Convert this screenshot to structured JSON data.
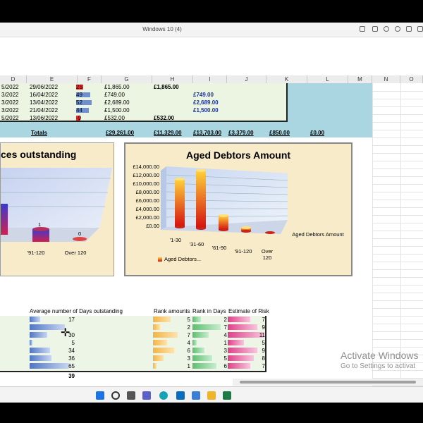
{
  "window": {
    "title": "Windows 10 (4)"
  },
  "colors": {
    "teal": "#a9d6e0",
    "table": "#ecf4e2",
    "blue_text": "#1a33a0",
    "chart_bg": "#f7ebc9"
  },
  "columns": [
    "D",
    "E",
    "F",
    "G",
    "H",
    "I",
    "J",
    "K",
    "L",
    "M",
    "N",
    "O"
  ],
  "rows": [
    {
      "d": "5/2022",
      "e": "29/06/2022",
      "f": "25",
      "g": "£1,865.00",
      "h": "£1,865.00",
      "i": "",
      "f_level": 0.3,
      "f_color": "#e03030"
    },
    {
      "d": "3/2022",
      "e": "16/04/2022",
      "f": "49",
      "g": "£749.00",
      "h": "",
      "i": "£749.00",
      "f_level": 0.55,
      "f_color": "#6f8fd0"
    },
    {
      "d": "3/2022",
      "e": "13/04/2022",
      "f": "52",
      "g": "£2,689.00",
      "h": "",
      "i": "£2,689.00",
      "f_level": 0.6,
      "f_color": "#6f8fd0"
    },
    {
      "d": "3/2022",
      "e": "21/04/2022",
      "f": "44",
      "g": "£1,500.00",
      "h": "",
      "i": "£1,500.00",
      "f_level": 0.5,
      "f_color": "#6f8fd0"
    },
    {
      "d": "5/2022",
      "e": "13/06/2022",
      "f": "-9",
      "g": "£532.00",
      "h": "£532.00",
      "i": "",
      "f_level": 0.1,
      "f_color": "#e03030"
    }
  ],
  "totals": {
    "label": "Totals",
    "g": "£29,261.00",
    "h": "£11,329.00",
    "i": "£13,703.00",
    "j": "£3,379.00",
    "k": "£850.00",
    "l": "£0.00"
  },
  "chart_data": [
    {
      "type": "bar",
      "title": "ces outstanding",
      "categories": [
        "'91-120",
        "Over 120"
      ],
      "values": [
        1,
        0
      ],
      "data_labels": [
        "1",
        "0"
      ]
    },
    {
      "type": "bar",
      "title": "Aged Debtors Amount",
      "categories": [
        "'1-30",
        "'31-60",
        "'61-90",
        "'91-120",
        "Over 120"
      ],
      "values": [
        11329,
        13703,
        3379,
        850,
        0
      ],
      "yticks": [
        "£14,000.00",
        "£12,000.00",
        "£10,000.00",
        "£8,000.00",
        "£6,000.00",
        "£4,000.00",
        "£2,000.00",
        "£0.00"
      ],
      "ylim": [
        0,
        14000
      ],
      "series_label": "Aged Debtors Amount",
      "legend": "Aged Debtors..."
    }
  ],
  "lower": {
    "headers": {
      "avg": "Average number of Days outstanding",
      "rank_amounts": "Rank amounts",
      "rank_days": "Rank in Days",
      "risk": "Estimate of Risk"
    },
    "rows": [
      {
        "avg": "17",
        "avg_level": 0.26,
        "ra": "5",
        "ra_level": 0.62,
        "rd": "2",
        "rd_level": 0.3,
        "risk": "7",
        "risk_level": 0.62
      },
      {
        "avg": "",
        "avg_level": 0.9,
        "ra": "2",
        "ra_level": 0.25,
        "rd": "7",
        "rd_level": 1.0,
        "risk": "9",
        "risk_level": 0.8
      },
      {
        "avg": "30",
        "avg_level": 0.45,
        "ra": "7",
        "ra_level": 0.88,
        "rd": "4",
        "rd_level": 0.57,
        "risk": "11",
        "risk_level": 1.0
      },
      {
        "avg": "5",
        "avg_level": 0.08,
        "ra": "4",
        "ra_level": 0.5,
        "rd": "1",
        "rd_level": 0.14,
        "risk": "5",
        "risk_level": 0.45
      },
      {
        "avg": "34",
        "avg_level": 0.52,
        "ra": "6",
        "ra_level": 0.75,
        "rd": "3",
        "rd_level": 0.43,
        "risk": "9",
        "risk_level": 0.8
      },
      {
        "avg": "36",
        "avg_level": 0.55,
        "ra": "3",
        "ra_level": 0.38,
        "rd": "5",
        "rd_level": 0.71,
        "risk": "8",
        "risk_level": 0.72
      },
      {
        "avg": "65",
        "avg_level": 1.0,
        "ra": "1",
        "ra_level": 0.12,
        "rd": "6",
        "rd_level": 0.86,
        "risk": "7",
        "risk_level": 0.62
      }
    ],
    "last": "39"
  },
  "watermark": {
    "line1": "Activate Windows",
    "line2": "Go to Settings to activat"
  }
}
